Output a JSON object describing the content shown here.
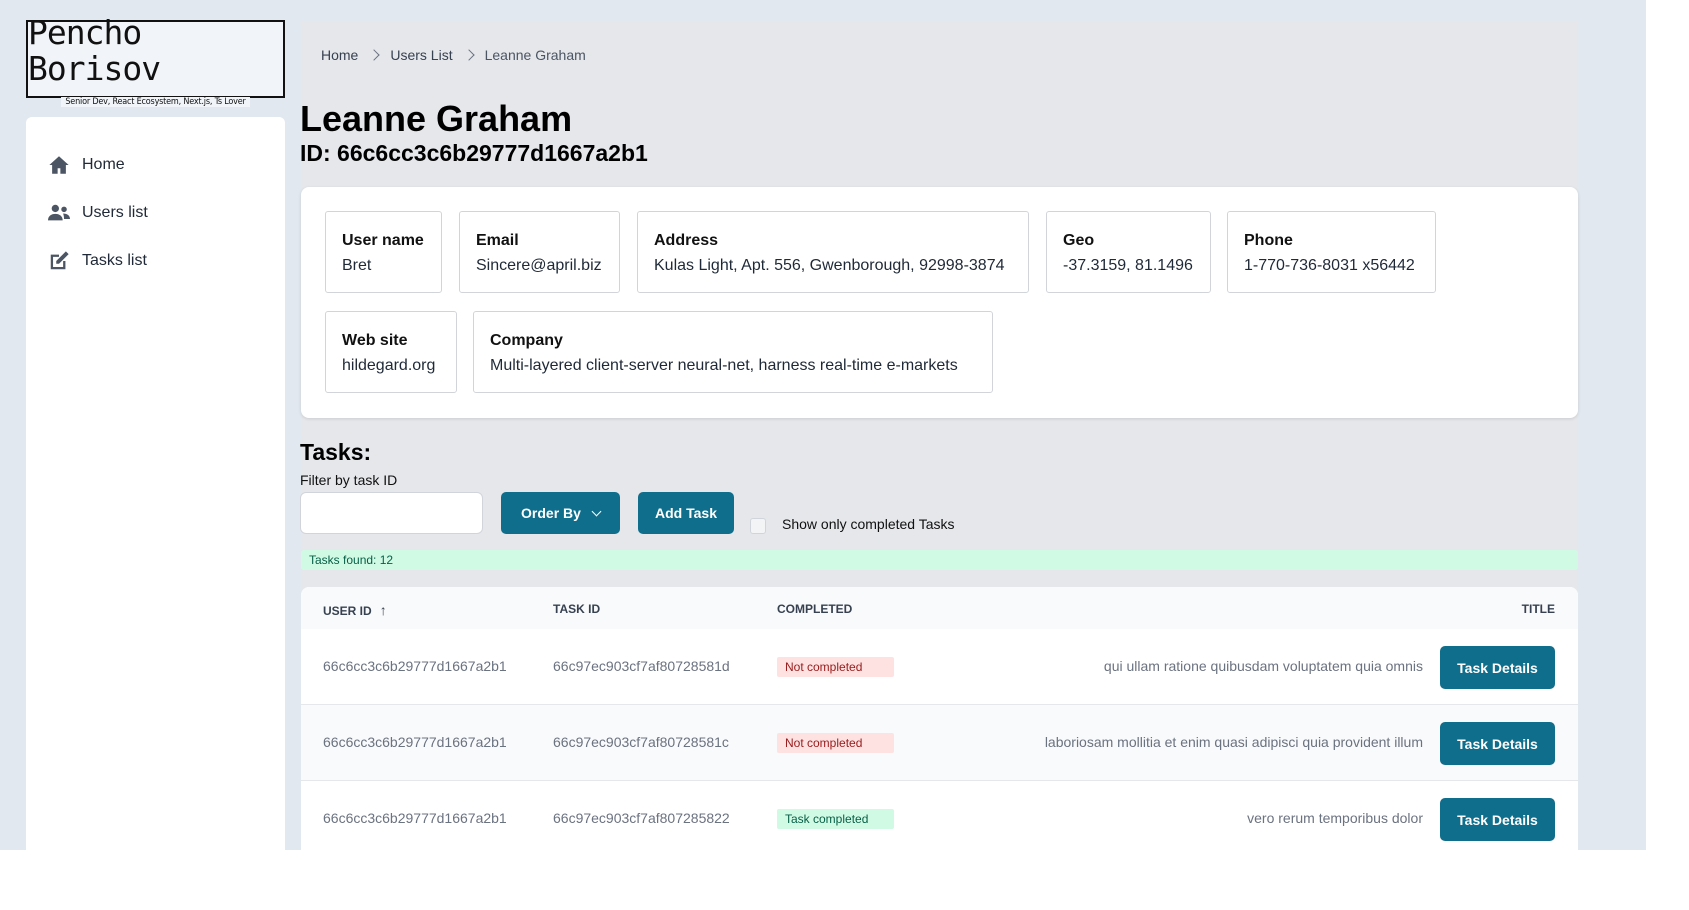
{
  "logo": {
    "name": "Pencho Borisov",
    "tagline": "Senior Dev, React Ecosystem, Next.js, Ts Lover"
  },
  "sidebar": {
    "items": [
      {
        "label": "Home",
        "icon": "home-icon"
      },
      {
        "label": "Users list",
        "icon": "users-icon"
      },
      {
        "label": "Tasks list",
        "icon": "edit-icon"
      }
    ]
  },
  "breadcrumb": [
    "Home",
    "Users List",
    "Leanne Graham"
  ],
  "user": {
    "name": "Leanne Graham",
    "id_line": "ID: 66c6cc3c6b29777d1667a2b1"
  },
  "fields": {
    "username": {
      "label": "User name",
      "value": "Bret"
    },
    "email": {
      "label": "Email",
      "value": "Sincere@april.biz"
    },
    "address": {
      "label": "Address",
      "value": "Kulas Light, Apt. 556, Gwenborough, 92998-3874"
    },
    "geo": {
      "label": "Geo",
      "value": "-37.3159, 81.1496"
    },
    "phone": {
      "label": "Phone",
      "value": "1-770-736-8031 x56442"
    },
    "website": {
      "label": "Web site",
      "value": "hildegard.org"
    },
    "company": {
      "label": "Company",
      "value": "Multi-layered client-server neural-net, harness real-time e-markets"
    }
  },
  "tasks": {
    "heading": "Tasks:",
    "filter_label": "Filter by task ID",
    "filter_value": "",
    "order_by_label": "Order By",
    "add_task_label": "Add Task",
    "show_completed_label": "Show only completed Tasks",
    "found_text": "Tasks found: 12"
  },
  "table": {
    "headers": {
      "user_id": "USER ID",
      "sort_arrow": "↑",
      "task_id": "TASK ID",
      "completed": "COMPLETED",
      "title": "TITLE"
    },
    "rows": [
      {
        "user_id": "66c6cc3c6b29777d1667a2b1",
        "task_id": "66c97ec903cf7af80728581d",
        "status": "Not completed",
        "title": "qui ullam ratione quibusdam voluptatem quia omnis",
        "action": "Task Details"
      },
      {
        "user_id": "66c6cc3c6b29777d1667a2b1",
        "task_id": "66c97ec903cf7af80728581c",
        "status": "Not completed",
        "title": "laboriosam mollitia et enim quasi adipisci quia provident illum",
        "action": "Task Details"
      },
      {
        "user_id": "66c6cc3c6b29777d1667a2b1",
        "task_id": "66c97ec903cf7af807285822",
        "status": "Task completed",
        "title": "vero rerum temporibus dolor",
        "action": "Task Details"
      }
    ]
  },
  "colors": {
    "primary": "#0f6e8c",
    "page_bg": "#e2e8f0",
    "success_bg": "#d1fae5",
    "danger_bg": "#fee2e2"
  }
}
